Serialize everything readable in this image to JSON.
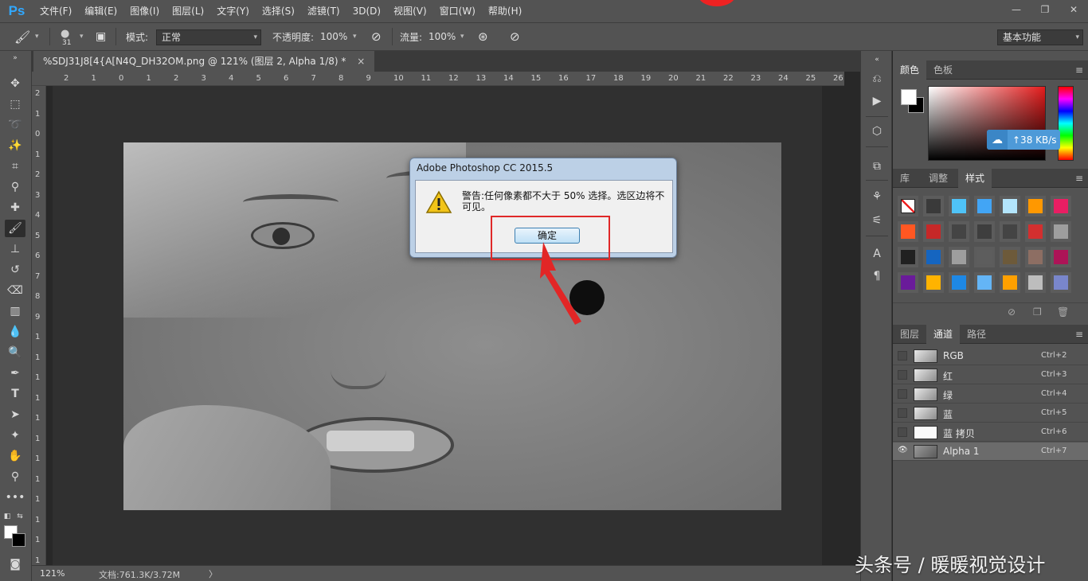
{
  "app": {
    "logo": "Ps",
    "menu": [
      "文件(F)",
      "编辑(E)",
      "图像(I)",
      "图层(L)",
      "文字(Y)",
      "选择(S)",
      "滤镜(T)",
      "3D(D)",
      "视图(V)",
      "窗口(W)",
      "帮助(H)"
    ],
    "window_controls": {
      "minimize": "—",
      "restore": "❐",
      "close": "✕"
    }
  },
  "options": {
    "brush_size": "31",
    "mode_label": "模式:",
    "mode_value": "正常",
    "opacity_label": "不透明度:",
    "opacity_value": "100%",
    "flow_label": "流量:",
    "flow_value": "100%",
    "workspace": "基本功能"
  },
  "document": {
    "tab_title": "%SDJ31J8[4{A[N4Q_DH32OM.png @ 121% (图层 2, Alpha 1/8) *",
    "close": "×"
  },
  "rulers": {
    "top": [
      "2",
      "1",
      "0",
      "1",
      "2",
      "3",
      "4",
      "5",
      "6",
      "7",
      "8",
      "9",
      "10",
      "11",
      "12",
      "13",
      "14",
      "15",
      "16",
      "17",
      "18",
      "19",
      "20",
      "21",
      "22",
      "23",
      "24",
      "25",
      "26"
    ],
    "left": [
      "2",
      "1",
      "0",
      "1",
      "2",
      "3",
      "4",
      "5",
      "6",
      "7",
      "8",
      "9",
      "1",
      "1",
      "1",
      "1",
      "1",
      "1",
      "1",
      "1",
      "1",
      "1",
      "1",
      "1"
    ]
  },
  "dialog": {
    "title": "Adobe Photoshop CC 2015.5",
    "message": "警告:任何像素都不大于 50% 选择。选区边将不可见。",
    "ok_label": "确定"
  },
  "status": {
    "zoom": "121%",
    "doc_info": "文档:761.3K/3.72M",
    "arrow": "〉"
  },
  "panels": {
    "color_tabs": [
      "颜色",
      "色板"
    ],
    "speed": "↑38 KB/s",
    "style_tabs": [
      "库",
      "调整",
      "样式"
    ],
    "channel_tabs": [
      "图层",
      "通道",
      "路径"
    ],
    "channels": [
      {
        "name": "RGB",
        "shortcut": "Ctrl+2",
        "thumb": "gray",
        "visible": false
      },
      {
        "name": "红",
        "shortcut": "Ctrl+3",
        "thumb": "gray",
        "visible": false
      },
      {
        "name": "绿",
        "shortcut": "Ctrl+4",
        "thumb": "gray",
        "visible": false
      },
      {
        "name": "蓝",
        "shortcut": "Ctrl+5",
        "thumb": "gray",
        "visible": false
      },
      {
        "name": "蓝 拷贝",
        "shortcut": "Ctrl+6",
        "thumb": "white",
        "visible": false
      },
      {
        "name": "Alpha 1",
        "shortcut": "Ctrl+7",
        "thumb": "dark",
        "visible": true
      }
    ],
    "style_swatches": [
      "#ffffff",
      "#3a3a3a",
      "#4fc3f7",
      "#42a5f5",
      "#b3e5fc",
      "#ff9800",
      "#e91e63",
      "#ff5722",
      "#c62828",
      "#444444",
      "#3e3e3e",
      "#444444",
      "#d32f2f",
      "#9e9e9e",
      "#212121",
      "#1565c0",
      "#9e9e9e",
      "#5d5d5d",
      "#6d5a3a",
      "#8d6e63",
      "#ad1457",
      "#6a1b9a",
      "#ffb300",
      "#1e88e5",
      "#64b5f6",
      "#ffa000",
      "#bdbdbd",
      "#7986cb"
    ]
  },
  "watermark": "头条号 / 暖暖视觉设计"
}
